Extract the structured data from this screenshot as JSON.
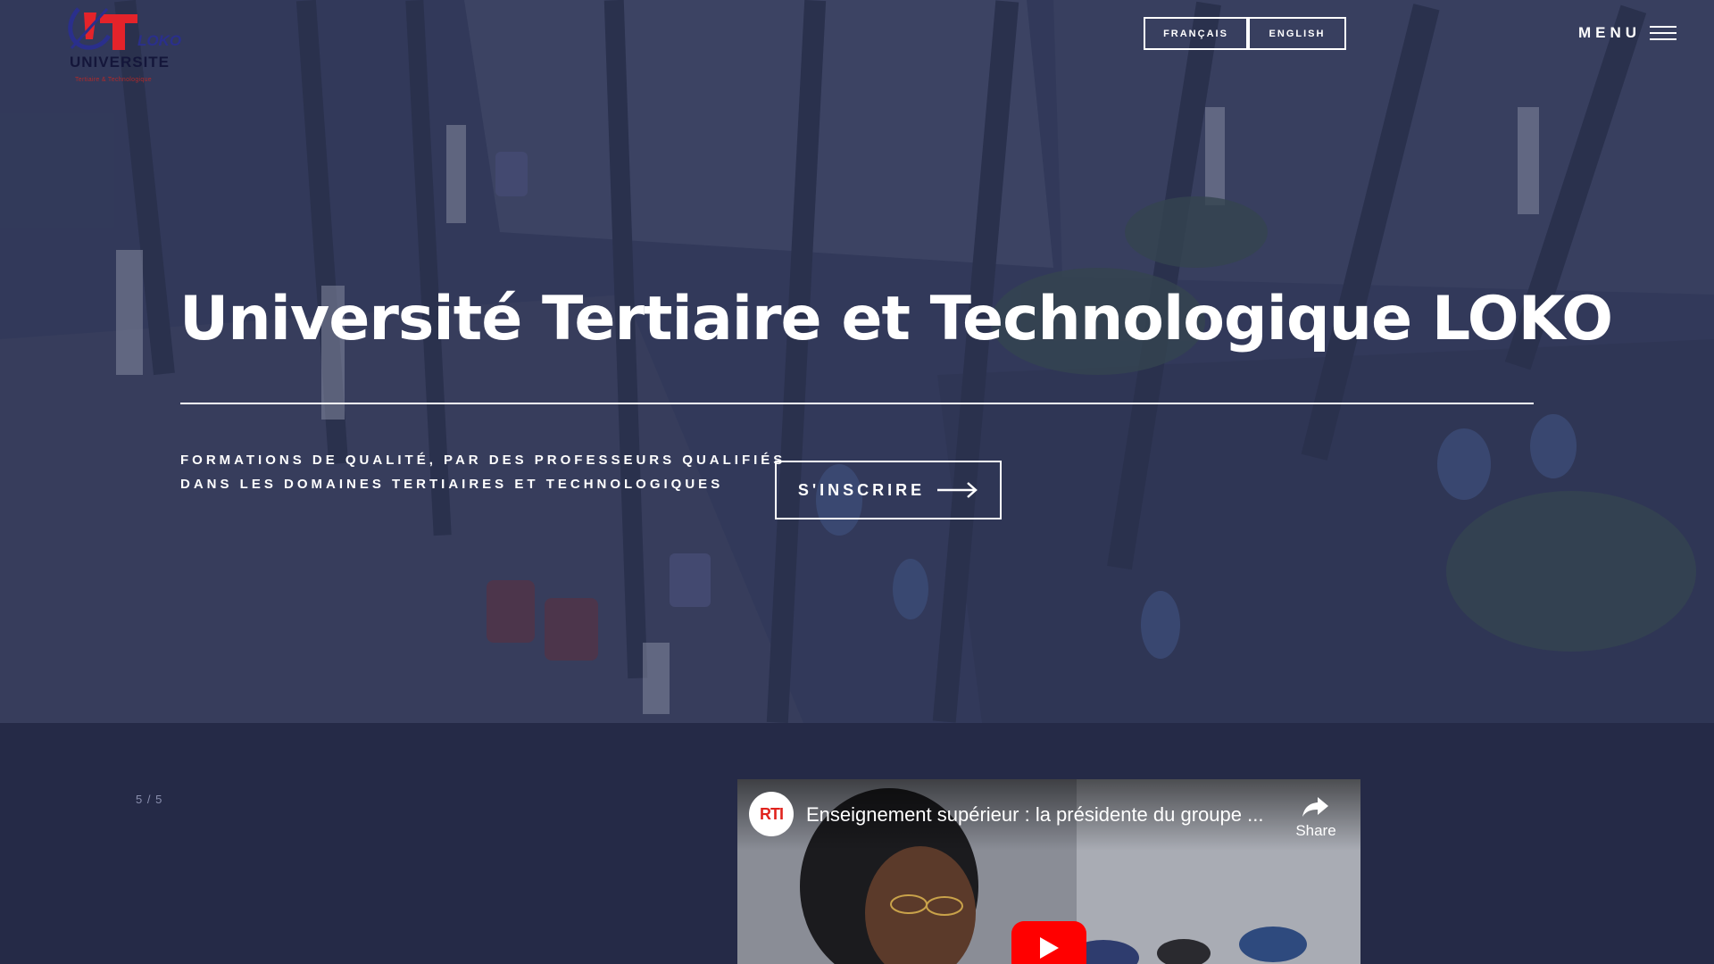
{
  "header": {
    "logo": {
      "brand": "LOKO",
      "name": "UNIVERSITE",
      "subtitle": "Tertiaire & Technologique"
    },
    "languages": [
      {
        "label": "FRANÇAIS"
      },
      {
        "label": "ENGLISH"
      }
    ],
    "menu_label": "MENU"
  },
  "hero": {
    "title": "Université Tertiaire et Technologique LOKO",
    "tagline_line1": "FORMATIONS DE QUALITÉ, PAR DES PROFESSEURS QUALIFIÉS",
    "tagline_line2": "DANS LES DOMAINES TERTIAIRES ET TECHNOLOGIQUES",
    "cta_label": "S'INSCRIRE"
  },
  "slider": {
    "counter": "5 / 5"
  },
  "video": {
    "channel": "RTI",
    "title": "Enseignement supérieur : la présidente du groupe ...",
    "share_label": "Share"
  },
  "colors": {
    "page_background": "#252a47",
    "hero_overlay": "#3a4261",
    "text": "#ffffff",
    "play_button": "#ff0000"
  },
  "icons": {
    "menu": "hamburger-icon",
    "cta": "arrow-right-icon",
    "share": "share-icon",
    "play": "play-icon"
  }
}
